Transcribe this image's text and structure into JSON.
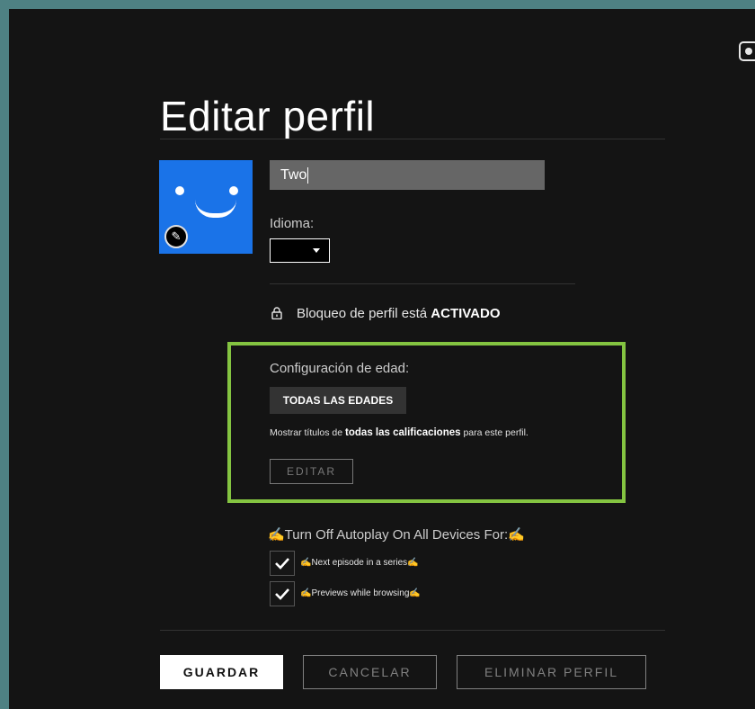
{
  "page_title": "Editar perfil",
  "profile": {
    "name_value": "Two",
    "language_label": "Idioma:",
    "language_value": ""
  },
  "lock": {
    "text_prefix": "Bloqueo de perfil está",
    "status": "ACTIVADO"
  },
  "age_settings": {
    "label": "Configuración de edad:",
    "rating": "TODAS LAS EDADES",
    "desc_prefix": "Mostrar títulos de",
    "desc_bold": "todas las calificaciones",
    "desc_suffix": "para este perfil.",
    "edit_button": "EDITAR",
    "highlight_color": "#84c441"
  },
  "autoplay": {
    "title": "✍Turn Off Autoplay On All Devices For:✍",
    "options": [
      {
        "label": "✍Next episode in a series✍",
        "checked": true
      },
      {
        "label": "✍Previews while browsing✍",
        "checked": true
      }
    ]
  },
  "actions": {
    "save": "GUARDAR",
    "cancel": "CANCELAR",
    "delete": "ELIMINAR PERFIL"
  },
  "icons": {
    "top_right": "scan-icon",
    "avatar_edit": "pencil-icon",
    "lock": "lock-icon",
    "check": "check-icon"
  },
  "colors": {
    "background": "#141414",
    "avatar": "#1a73e8",
    "accent_box": "#84c441"
  }
}
